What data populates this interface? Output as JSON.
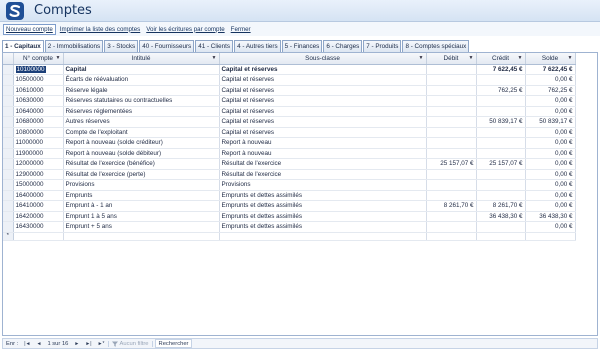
{
  "app": {
    "title": "Comptes"
  },
  "menu": [
    {
      "label": "Nouveau compte",
      "name": "new-account-button"
    },
    {
      "label": "Imprimer la liste des comptes",
      "name": "print-accounts-button"
    },
    {
      "label": "Voir les écritures par compte",
      "name": "view-entries-button"
    },
    {
      "label": "Fermer",
      "name": "close-button"
    }
  ],
  "tabs": [
    "1 - Capitaux",
    "2 - Immobilisations",
    "3 - Stocks",
    "40 - Fournisseurs",
    "41 - Clients",
    "4 - Autres tiers",
    "5 - Finances",
    "6 - Charges",
    "7 - Produits",
    "8 - Comptes spéciaux"
  ],
  "active_tab": 0,
  "table": {
    "columns": [
      "N° compte",
      "Intitulé",
      "Sous-classe",
      "Débit",
      "Crédit",
      "Solde"
    ],
    "rows": [
      [
        "10100000",
        "Capital",
        "Capital et réserves",
        "",
        "7 622,45 €",
        "7 622,45 €"
      ],
      [
        "10500000",
        "Écarts de réévaluation",
        "Capital et réserves",
        "",
        "",
        "0,00 €"
      ],
      [
        "10610000",
        "Réserve légale",
        "Capital et réserves",
        "",
        "762,25 €",
        "762,25 €"
      ],
      [
        "10630000",
        "Réserves statutaires ou contractuelles",
        "Capital et réserves",
        "",
        "",
        "0,00 €"
      ],
      [
        "10640000",
        "Réserves réglementées",
        "Capital et réserves",
        "",
        "",
        "0,00 €"
      ],
      [
        "10680000",
        "Autres réserves",
        "Capital et réserves",
        "",
        "50 839,17 €",
        "50 839,17 €"
      ],
      [
        "10800000",
        "Compte de l'exploitant",
        "Capital et réserves",
        "",
        "",
        "0,00 €"
      ],
      [
        "11000000",
        "Report à nouveau (solde créditeur)",
        "Report à nouveau",
        "",
        "",
        "0,00 €"
      ],
      [
        "11900000",
        "Report à nouveau (solde débiteur)",
        "Report à nouveau",
        "",
        "",
        "0,00 €"
      ],
      [
        "12000000",
        "Résultat de l'exercice (bénéfice)",
        "Résultat de l'exercice",
        "25 157,07 €",
        "25 157,07 €",
        "0,00 €"
      ],
      [
        "12900000",
        "Résultat de l'exercice (perte)",
        "Résultat de l'exercice",
        "",
        "",
        "0,00 €"
      ],
      [
        "15000000",
        "Provisions",
        "Provisions",
        "",
        "",
        "0,00 €"
      ],
      [
        "16400000",
        "Emprunts",
        "Emprunts et dettes assimilés",
        "",
        "",
        "0,00 €"
      ],
      [
        "16410000",
        "Emprunt à - 1 an",
        "Emprunts et dettes assimilés",
        "8 261,70 €",
        "8 261,70 €",
        "0,00 €"
      ],
      [
        "16420000",
        "Emprunt 1 à 5 ans",
        "Emprunts et dettes assimilés",
        "",
        "36 438,30 €",
        "36 438,30 €"
      ],
      [
        "16430000",
        "Emprunt + 5 ans",
        "Emprunts et dettes assimilés",
        "",
        "",
        "0,00 €"
      ]
    ],
    "new_row_marker": "*"
  },
  "status": {
    "record_label": "Enr :",
    "position": "1 sur 16",
    "filter": "Aucun filtre",
    "search": "Rechercher",
    "nav_first": "|◄",
    "nav_prev": "◄",
    "nav_next": "►",
    "nav_last": "►|",
    "nav_new": "►*"
  },
  "colors": {
    "accent": "#1c3f78",
    "title": "#15335f",
    "header_bg": "#d5e3f3"
  }
}
